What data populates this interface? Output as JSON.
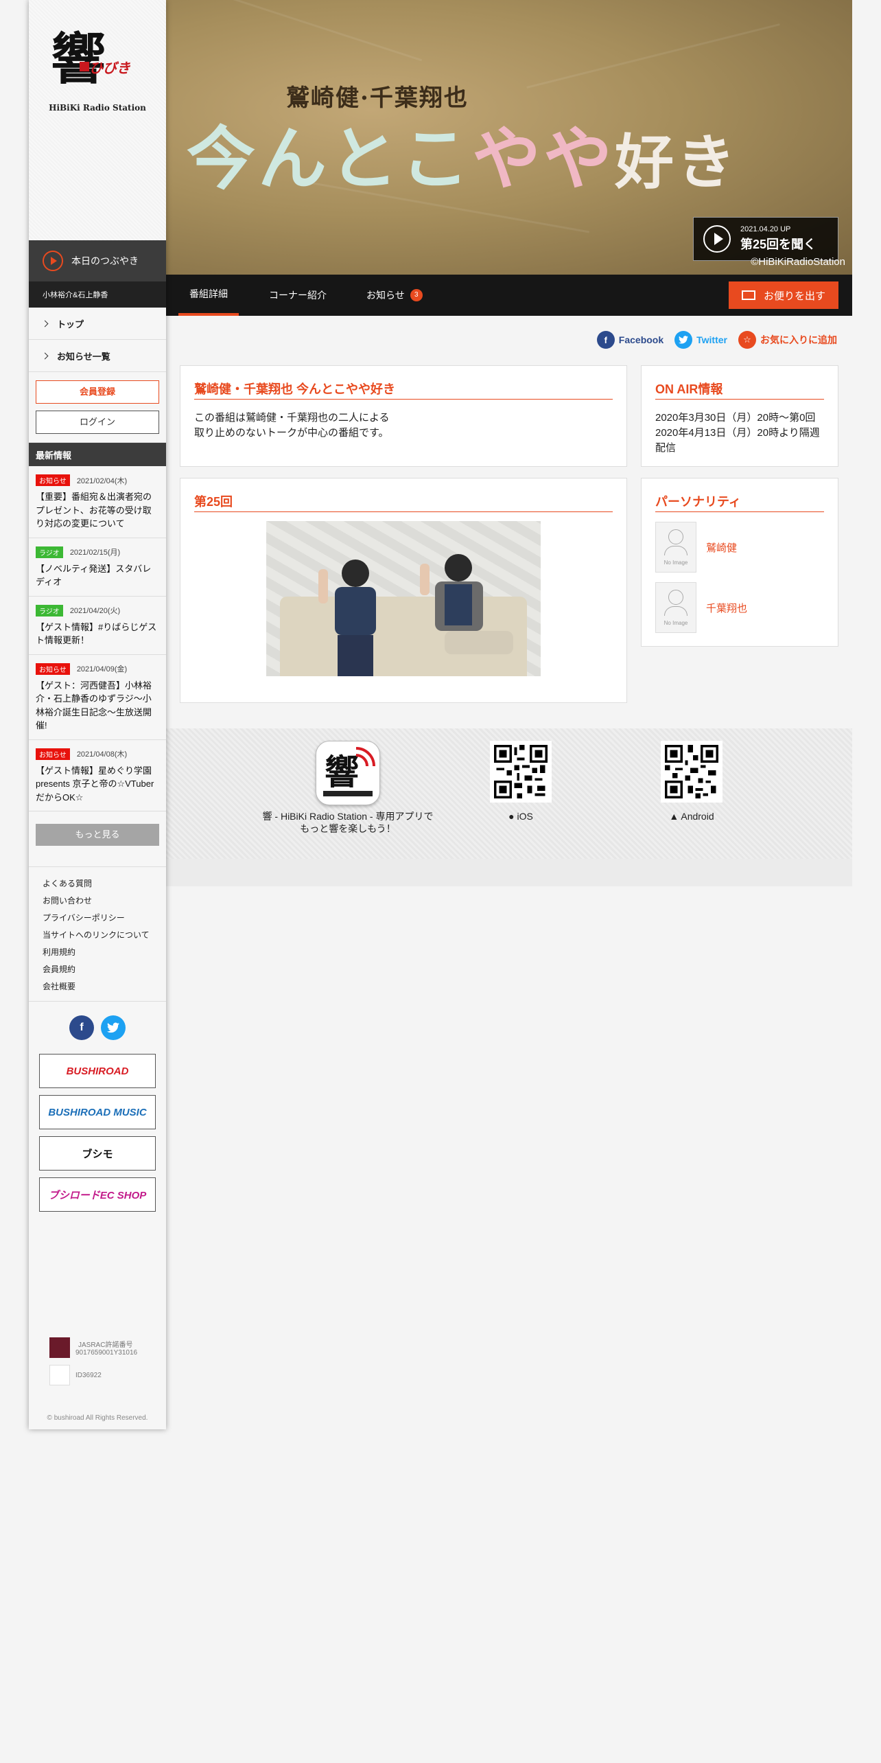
{
  "sidebar": {
    "logo_text": "HiBiKi Radio Station",
    "tsubuyaki_label": "本日のつぶやき",
    "tsubuyaki_sub": "小林裕介&石上静香",
    "nav": [
      {
        "label": "トップ"
      },
      {
        "label": "お知らせ一覧"
      }
    ],
    "register_label": "会員登録",
    "login_label": "ログイン",
    "news_header": "最新情報",
    "news": [
      {
        "badge": "お知らせ",
        "badge_color": "#e8120c",
        "date": "2021/02/04(木)",
        "title": "【重要】番組宛＆出演者宛のプレゼント、お花等の受け取り対応の変更について"
      },
      {
        "badge": "ラジオ",
        "badge_color": "#3cb834",
        "date": "2021/02/15(月)",
        "title": "【ノベルティ発送】スタバレディオ"
      },
      {
        "badge": "ラジオ",
        "badge_color": "#3cb834",
        "date": "2021/04/20(火)",
        "title": "【ゲスト情報】#りばらじゲスト情報更新！"
      },
      {
        "badge": "お知らせ",
        "badge_color": "#e8120c",
        "date": "2021/04/09(金)",
        "title": "【ゲスト：河西健吾】小林裕介・石上静香のゆずラジ～小林裕介誕生日記念～生放送開催!"
      },
      {
        "badge": "お知らせ",
        "badge_color": "#e8120c",
        "date": "2021/04/08(木)",
        "title": "【ゲスト情報】星めぐり学園presents 京子と帝の☆VTuberだからOK☆"
      }
    ],
    "more_label": "もっと見る",
    "footer_links": [
      "よくある質問",
      "お問い合わせ",
      "プライバシーポリシー",
      "当サイトへのリンクについて",
      "利用規約",
      "会員規約",
      "会社概要"
    ],
    "banners": [
      "BUSHIROAD",
      "BUSHIROAD MUSIC",
      "ブシモ",
      "ブシロードEC SHOP"
    ],
    "license_jasrac_label": "JASRAC許諾番号",
    "license_jasrac_number": "9017659001Y31016",
    "license_id": "ID36922",
    "copyright": "© bushiroad All Rights Reserved."
  },
  "hero": {
    "subtitle": "鷲崎健·千葉翔也",
    "title_1": "今んとこ",
    "title_2": "やや",
    "title_3": "好き",
    "play_date": "2021.04.20 UP",
    "play_label": "第25回を聞く",
    "credit": "©HiBiKiRadioStation"
  },
  "tabs": [
    {
      "label": "番組詳細",
      "active": true
    },
    {
      "label": "コーナー紹介",
      "active": false
    },
    {
      "label": "お知らせ",
      "active": false,
      "count": "3"
    }
  ],
  "letter_label": "お便りを出す",
  "share": {
    "facebook": "Facebook",
    "twitter": "Twitter",
    "favorite": "お気に入りに追加"
  },
  "detail": {
    "heading": "鷲崎健・千葉翔也 今んとこやや好き",
    "body_line1": "この番組は鷲崎健・千葉翔也の二人による",
    "body_line2": "取り止めのないトークが中心の番組です。"
  },
  "onair": {
    "heading": "ON AIR情報",
    "line1": "2020年3月30日（月）20時～第0回",
    "line2": "2020年4月13日（月）20時より隔週",
    "line3": "配信"
  },
  "episode": {
    "heading": "第25回"
  },
  "personality": {
    "heading": "パーソナリティ",
    "no_image": "No Image",
    "members": [
      {
        "name": "鷲崎健"
      },
      {
        "name": "千葉翔也"
      }
    ]
  },
  "app": {
    "text_line1": "響 - HiBiKi Radio Station - 専用アプリで",
    "text_line2": "もっと響を楽しもう！",
    "ios_label": "iOS",
    "android_label": "Android"
  },
  "colors": {
    "accent": "#e84a1f",
    "facebook": "#2c4a8c",
    "twitter": "#1da1f2"
  }
}
